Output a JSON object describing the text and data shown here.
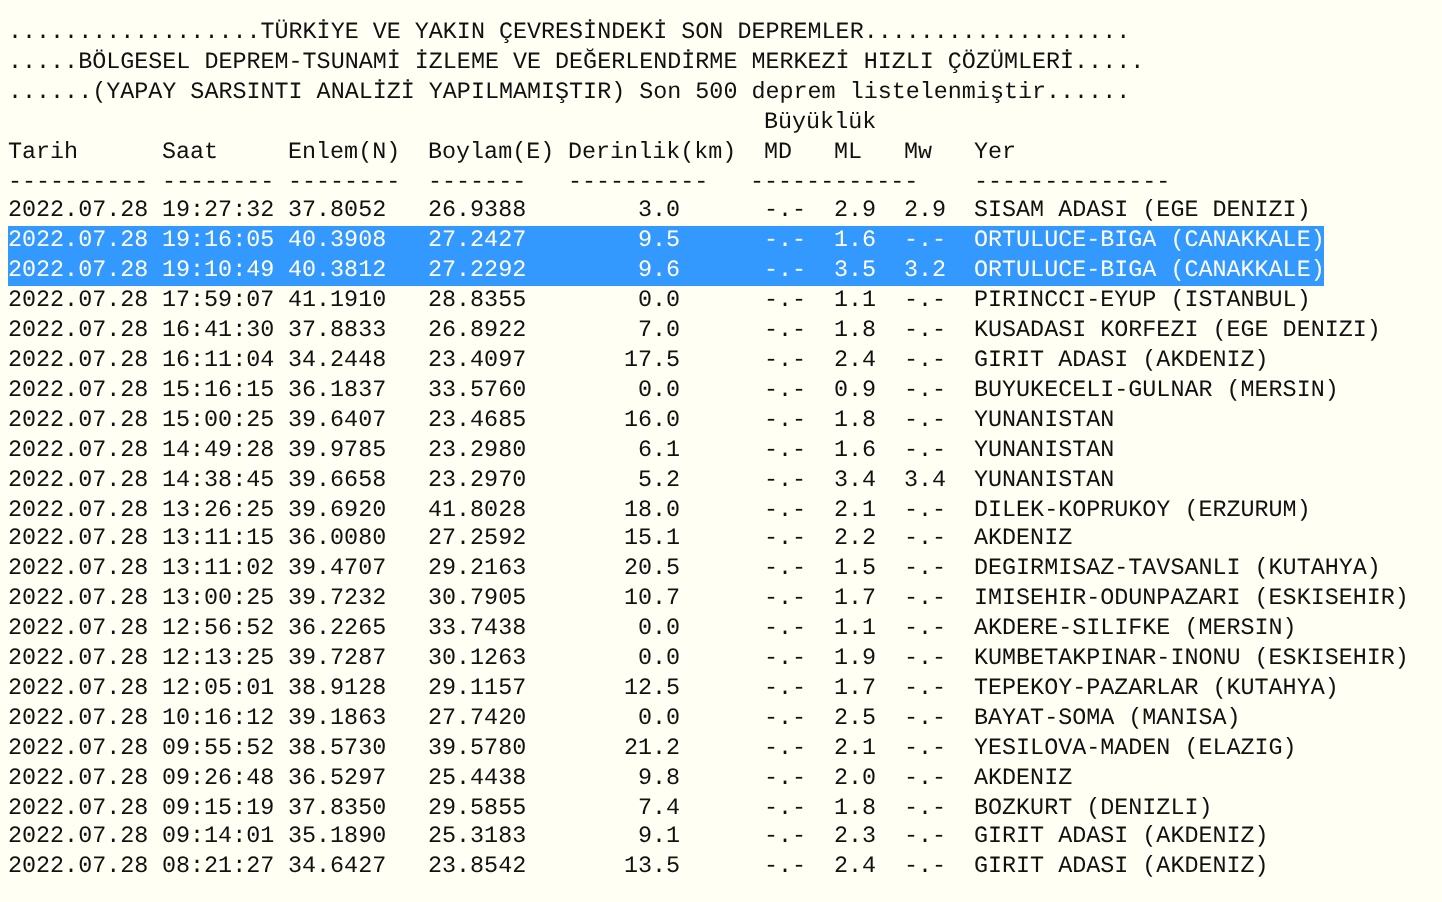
{
  "title_lines": [
    "..................TÜRKİYE VE YAKIN ÇEVRESİNDEKİ SON DEPREMLER...................",
    ".....BÖLGESEL DEPREM-TSUNAMİ İZLEME VE DEĞERLENDİRME MERKEZİ HIZLI ÇÖZÜMLERİ.....",
    "......(YAPAY SARSINTI ANALİZİ YAPILMAMIŞTIR) Son 500 deprem listelenmiştir......"
  ],
  "magnitude_group": "Büyüklük",
  "columns": [
    "Tarih",
    "Saat",
    "Enlem(N)",
    "Boylam(E)",
    "Derinlik(km)",
    "MD",
    "ML",
    "Mw",
    "Yer"
  ],
  "rules": [
    "----------",
    "--------",
    "--------",
    "-------",
    "----------",
    "------------",
    "--------------"
  ],
  "rows": [
    {
      "selected": false,
      "cells": [
        "2022.07.28",
        "19:27:32",
        "37.8052",
        "26.9388",
        "3.0",
        "-.-",
        "2.9",
        "2.9",
        "SISAM ADASI (EGE DENIZI)"
      ]
    },
    {
      "selected": true,
      "cells": [
        "2022.07.28",
        "19:16:05",
        "40.3908",
        "27.2427",
        "9.5",
        "-.-",
        "1.6",
        "-.-",
        "ORTULUCE-BIGA (CANAKKALE)"
      ]
    },
    {
      "selected": true,
      "cells": [
        "2022.07.28",
        "19:10:49",
        "40.3812",
        "27.2292",
        "9.6",
        "-.-",
        "3.5",
        "3.2",
        "ORTULUCE-BIGA (CANAKKALE)"
      ]
    },
    {
      "selected": false,
      "cells": [
        "2022.07.28",
        "17:59:07",
        "41.1910",
        "28.8355",
        "0.0",
        "-.-",
        "1.1",
        "-.-",
        "PIRINCCI-EYUP (ISTANBUL)"
      ]
    },
    {
      "selected": false,
      "cells": [
        "2022.07.28",
        "16:41:30",
        "37.8833",
        "26.8922",
        "7.0",
        "-.-",
        "1.8",
        "-.-",
        "KUSADASI KORFEZI (EGE DENIZI)"
      ]
    },
    {
      "selected": false,
      "cells": [
        "2022.07.28",
        "16:11:04",
        "34.2448",
        "23.4097",
        "17.5",
        "-.-",
        "2.4",
        "-.-",
        "GIRIT ADASI (AKDENIZ)"
      ]
    },
    {
      "selected": false,
      "cells": [
        "2022.07.28",
        "15:16:15",
        "36.1837",
        "33.5760",
        "0.0",
        "-.-",
        "0.9",
        "-.-",
        "BUYUKECELI-GULNAR (MERSIN)"
      ]
    },
    {
      "selected": false,
      "cells": [
        "2022.07.28",
        "15:00:25",
        "39.6407",
        "23.4685",
        "16.0",
        "-.-",
        "1.8",
        "-.-",
        "YUNANISTAN"
      ]
    },
    {
      "selected": false,
      "cells": [
        "2022.07.28",
        "14:49:28",
        "39.9785",
        "23.2980",
        "6.1",
        "-.-",
        "1.6",
        "-.-",
        "YUNANISTAN"
      ]
    },
    {
      "selected": false,
      "cells": [
        "2022.07.28",
        "14:38:45",
        "39.6658",
        "23.2970",
        "5.2",
        "-.-",
        "3.4",
        "3.4",
        "YUNANISTAN"
      ]
    },
    {
      "selected": false,
      "cells": [
        "2022.07.28",
        "13:26:25",
        "39.6920",
        "41.8028",
        "18.0",
        "-.-",
        "2.1",
        "-.-",
        "DILEK-KOPRUKOY (ERZURUM)"
      ]
    },
    {
      "selected": false,
      "cells": [
        "2022.07.28",
        "13:11:15",
        "36.0080",
        "27.2592",
        "15.1",
        "-.-",
        "2.2",
        "-.-",
        "AKDENIZ"
      ]
    },
    {
      "selected": false,
      "cells": [
        "2022.07.28",
        "13:11:02",
        "39.4707",
        "29.2163",
        "20.5",
        "-.-",
        "1.5",
        "-.-",
        "DEGIRMISAZ-TAVSANLI (KUTAHYA)"
      ]
    },
    {
      "selected": false,
      "cells": [
        "2022.07.28",
        "13:00:25",
        "39.7232",
        "30.7905",
        "10.7",
        "-.-",
        "1.7",
        "-.-",
        "IMISEHIR-ODUNPAZARI (ESKISEHIR)"
      ]
    },
    {
      "selected": false,
      "cells": [
        "2022.07.28",
        "12:56:52",
        "36.2265",
        "33.7438",
        "0.0",
        "-.-",
        "1.1",
        "-.-",
        "AKDERE-SILIFKE (MERSIN)"
      ]
    },
    {
      "selected": false,
      "cells": [
        "2022.07.28",
        "12:13:25",
        "39.7287",
        "30.1263",
        "0.0",
        "-.-",
        "1.9",
        "-.-",
        "KUMBETAKPINAR-INONU (ESKISEHIR)"
      ]
    },
    {
      "selected": false,
      "cells": [
        "2022.07.28",
        "12:05:01",
        "38.9128",
        "29.1157",
        "12.5",
        "-.-",
        "1.7",
        "-.-",
        "TEPEKOY-PAZARLAR (KUTAHYA)"
      ]
    },
    {
      "selected": false,
      "cells": [
        "2022.07.28",
        "10:16:12",
        "39.1863",
        "27.7420",
        "0.0",
        "-.-",
        "2.5",
        "-.-",
        "BAYAT-SOMA (MANISA)"
      ]
    },
    {
      "selected": false,
      "cells": [
        "2022.07.28",
        "09:55:52",
        "38.5730",
        "39.5780",
        "21.2",
        "-.-",
        "2.1",
        "-.-",
        "YESILOVA-MADEN (ELAZIG)"
      ]
    },
    {
      "selected": false,
      "cells": [
        "2022.07.28",
        "09:26:48",
        "36.5297",
        "25.4438",
        "9.8",
        "-.-",
        "2.0",
        "-.-",
        "AKDENIZ"
      ]
    },
    {
      "selected": false,
      "cells": [
        "2022.07.28",
        "09:15:19",
        "37.8350",
        "29.5855",
        "7.4",
        "-.-",
        "1.8",
        "-.-",
        "BOZKURT (DENIZLI)"
      ]
    },
    {
      "selected": false,
      "cells": [
        "2022.07.28",
        "09:14:01",
        "35.1890",
        "25.3183",
        "9.1",
        "-.-",
        "2.3",
        "-.-",
        "GIRIT ADASI (AKDENIZ)"
      ]
    },
    {
      "selected": false,
      "cells": [
        "2022.07.28",
        "08:21:27",
        "34.6427",
        "23.8542",
        "13.5",
        "-.-",
        "2.4",
        "-.-",
        "GIRIT ADASI (AKDENIZ)"
      ]
    }
  ]
}
